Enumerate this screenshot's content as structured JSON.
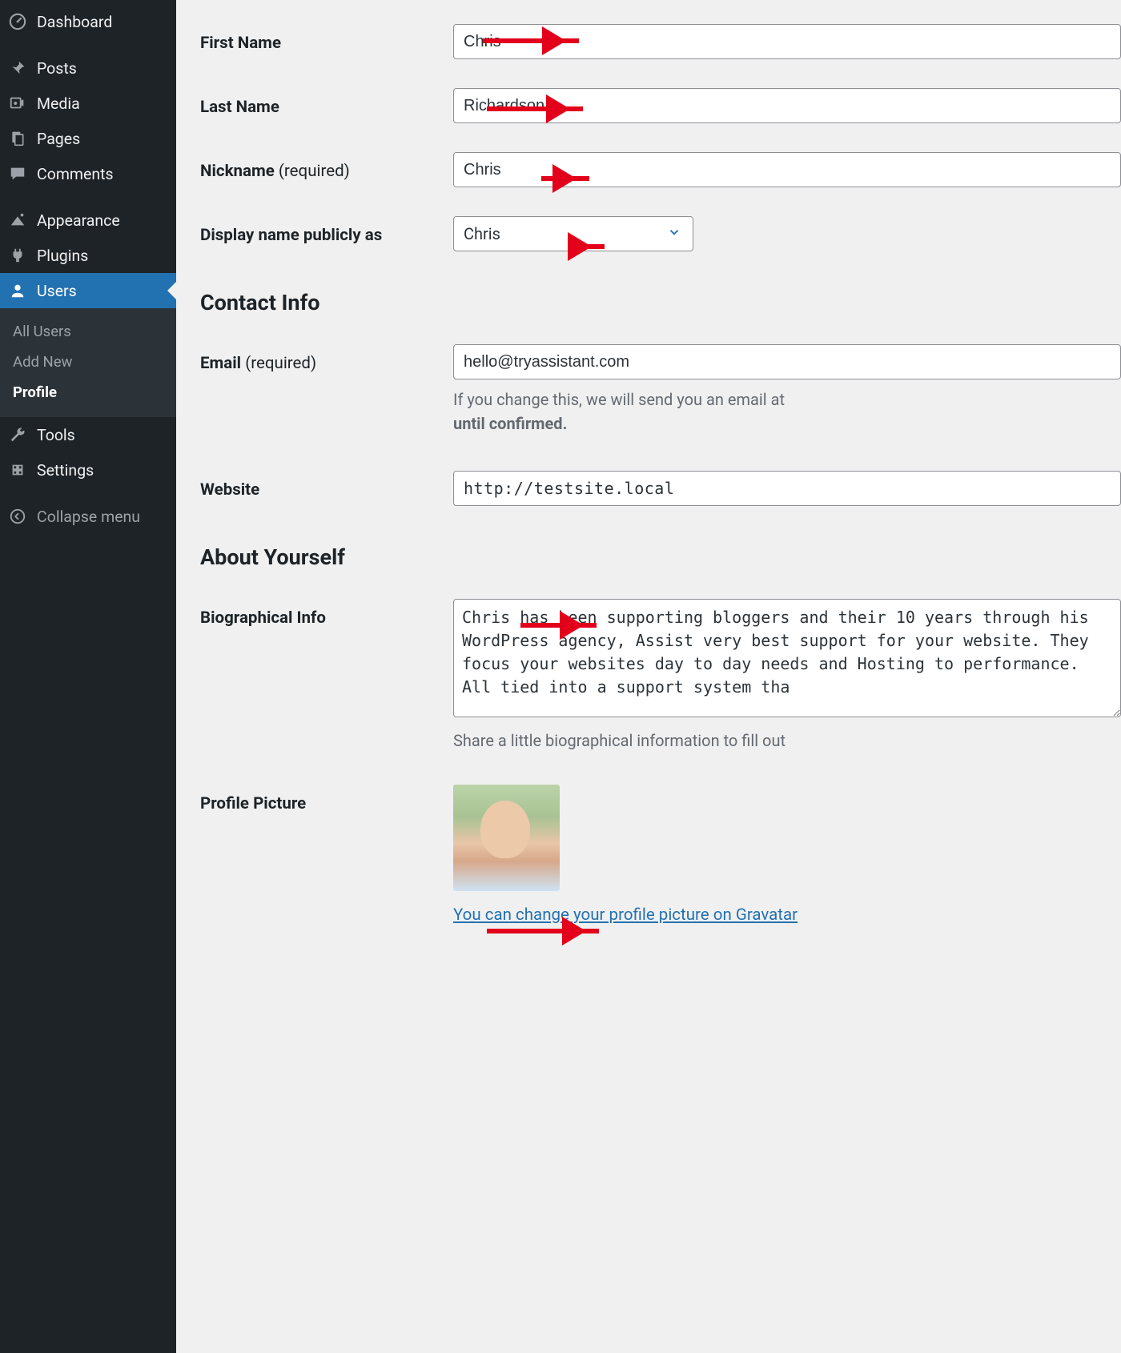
{
  "sidebar": {
    "items": [
      {
        "label": "Dashboard",
        "icon": "dashboard"
      },
      {
        "label": "Posts",
        "icon": "pin"
      },
      {
        "label": "Media",
        "icon": "media"
      },
      {
        "label": "Pages",
        "icon": "pages"
      },
      {
        "label": "Comments",
        "icon": "comments"
      },
      {
        "label": "Appearance",
        "icon": "appearance"
      },
      {
        "label": "Plugins",
        "icon": "plugins"
      },
      {
        "label": "Users",
        "icon": "users",
        "active": true
      },
      {
        "label": "Tools",
        "icon": "tools"
      },
      {
        "label": "Settings",
        "icon": "settings"
      }
    ],
    "submenu": [
      {
        "label": "All Users"
      },
      {
        "label": "Add New"
      },
      {
        "label": "Profile",
        "current": true
      }
    ],
    "collapse_label": "Collapse menu"
  },
  "profile": {
    "first_name": {
      "label": "First Name",
      "value": "Chris"
    },
    "last_name": {
      "label": "Last Name",
      "value": "Richardson"
    },
    "nickname": {
      "label": "Nickname ",
      "required_suffix": "(required)",
      "value": "Chris"
    },
    "display_name": {
      "label": "Display name publicly as",
      "value": "Chris"
    },
    "contact_heading": "Contact Info",
    "email": {
      "label": "Email ",
      "required_suffix": "(required)",
      "value": "hello@tryassistant.com",
      "helper_prefix": "If you change this, we will send you an email at ",
      "helper_bold": "until confirmed."
    },
    "website": {
      "label": "Website",
      "value": "http://testsite.local"
    },
    "about_heading": "About Yourself",
    "bio": {
      "label": "Biographical Info",
      "value": "Chris has been supporting bloggers and their 10 years through his WordPress agency, Assist very best support for your website. They focus your websites day to day needs and Hosting to performance. All tied into a support system tha",
      "helper": "Share a little biographical information to fill out "
    },
    "profile_picture": {
      "label": "Profile Picture",
      "gravatar_link": "You can change your profile picture on Gravatar"
    }
  }
}
